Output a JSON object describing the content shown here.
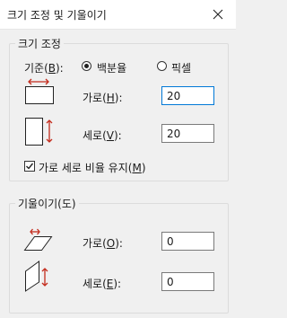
{
  "window": {
    "title": "크기 조정 및 기울이기"
  },
  "resize": {
    "legend": "크기 조정",
    "basis_label": "기준(B):",
    "basis_prefix": "기준(",
    "basis_key": "B",
    "basis_suffix": "):",
    "percent_label": "백분율",
    "pixel_label": "픽셀",
    "selected": "percent",
    "horizontal_prefix": "가로(",
    "horizontal_key": "H",
    "horizontal_suffix": "):",
    "horizontal_value": "20",
    "vertical_prefix": "세로(",
    "vertical_key": "V",
    "vertical_suffix": "):",
    "vertical_value": "20",
    "keep_ratio_prefix": "가로 세로 비율 유지(",
    "keep_ratio_key": "M",
    "keep_ratio_suffix": ")",
    "keep_ratio_checked": true
  },
  "skew": {
    "legend": "기울이기(도)",
    "horizontal_prefix": "가로(",
    "horizontal_key": "O",
    "horizontal_suffix": "):",
    "horizontal_value": "0",
    "vertical_prefix": "세로(",
    "vertical_key": "E",
    "vertical_suffix": "):",
    "vertical_value": "0"
  },
  "colors": {
    "arrow": "#c42b1c",
    "focus": "#0078d7"
  }
}
